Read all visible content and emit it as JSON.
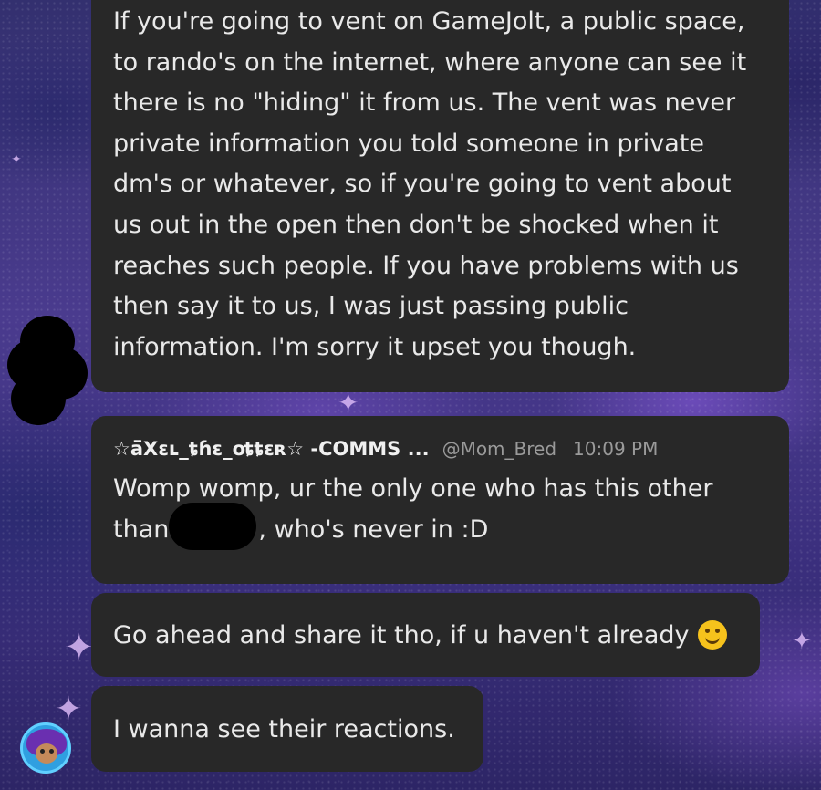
{
  "messages": [
    {
      "text": "If you're going to vent on GameJolt, a public space,\nto rando's on the internet, where anyone can see it\nthere is no \"hiding\" it from us. The vent was never\nprivate information you told someone in private\ndm's or whatever, so if you're going to vent about\nus out in the open then don't be shocked when it\nreaches such people. If you have problems with us\nthen say it to us, I was just passing public\ninformation. I'm sorry it upset you though."
    },
    {
      "author": "☆ä̈Xɛʟ_ȶɦɛ_օȶȶɛʀ☆ -COMMS ...",
      "handle": "@Mom_Bred",
      "time": "10:09 PM",
      "text_before": "Womp womp, ur the only one who has this other",
      "text_line2_start": "than",
      "text_line2_end": ", who's never in :D"
    },
    {
      "text": "Go ahead and share it tho, if u haven't already",
      "emoji": "smiling-face-icon"
    },
    {
      "text": "I wanna see their reactions."
    }
  ],
  "colors": {
    "bubble": "#282828",
    "text": "#e9e9e9",
    "meta": "#9a9a9a",
    "background": "#3a2f78"
  }
}
